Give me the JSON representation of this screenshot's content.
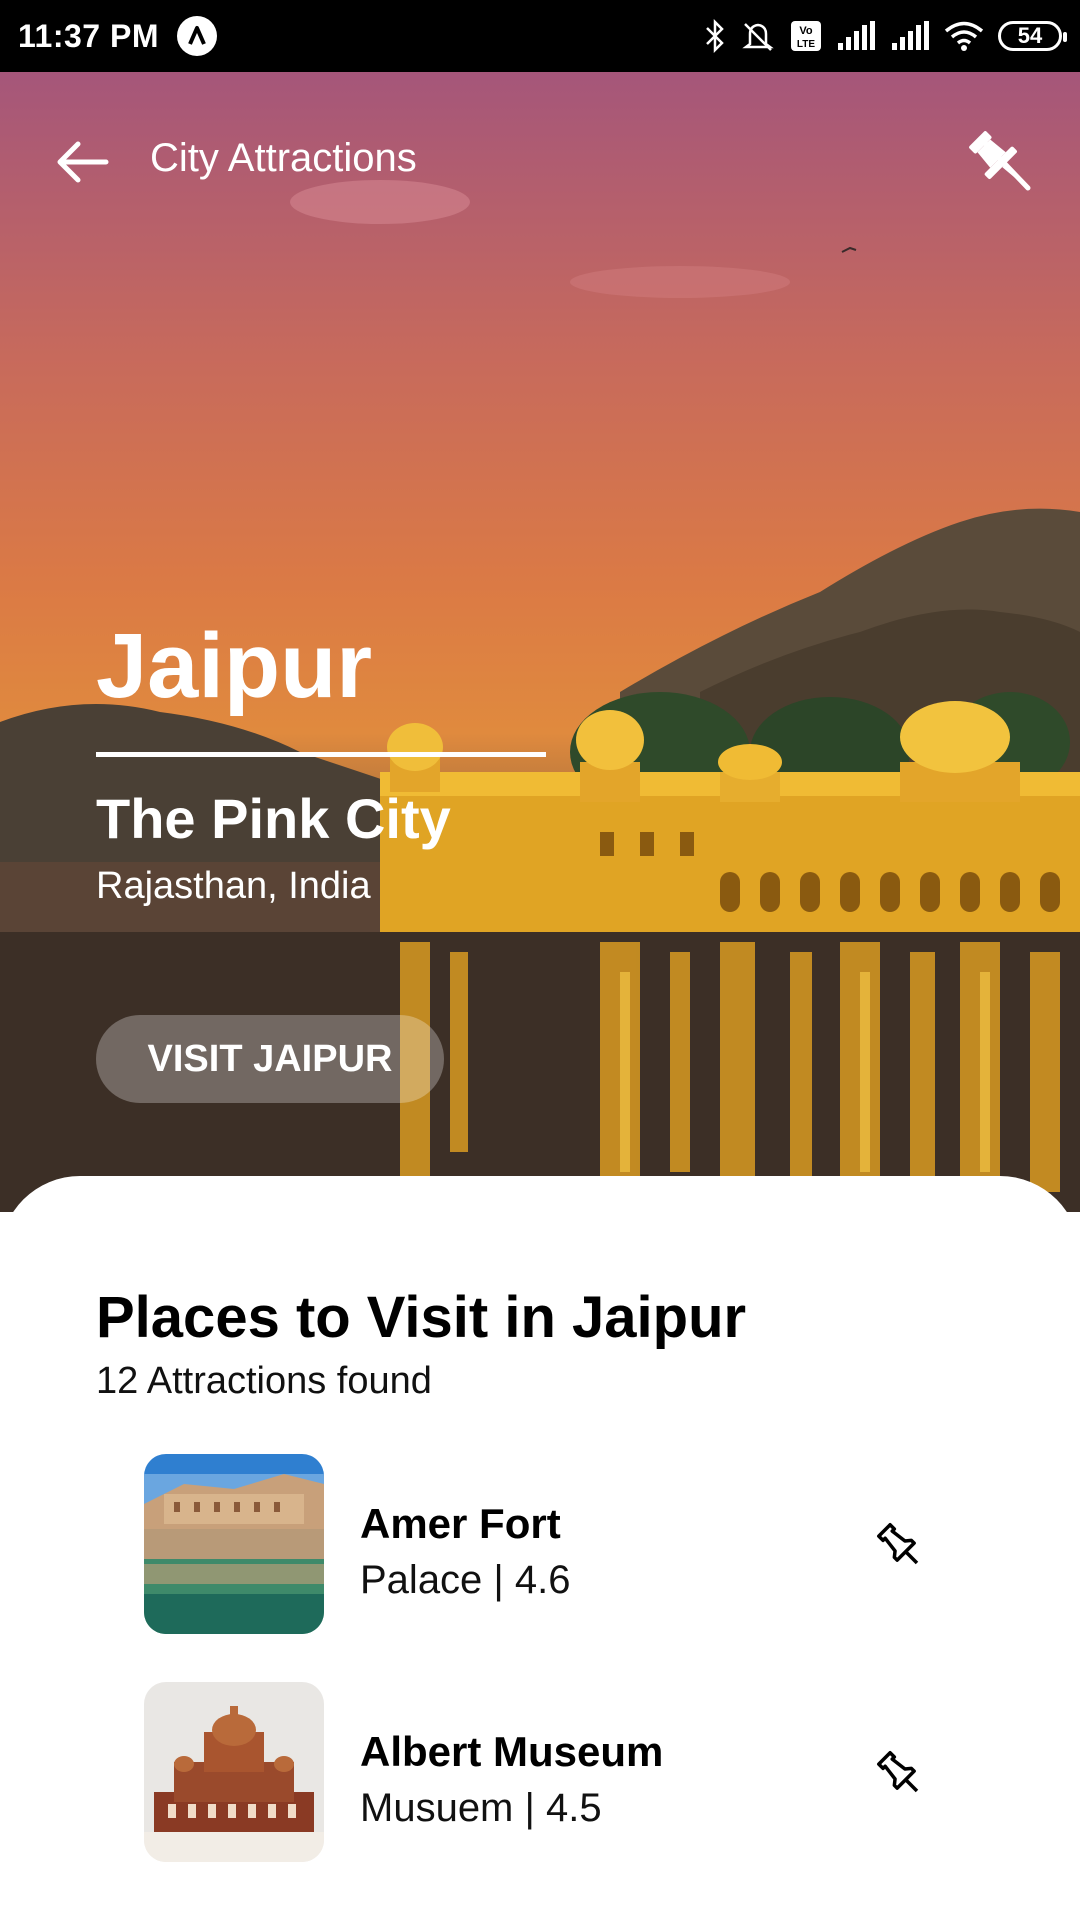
{
  "status_bar": {
    "time": "11:37 PM",
    "battery": "54",
    "icons": [
      "app-icon",
      "bluetooth-icon",
      "mute-icon",
      "volte-icon",
      "signal-icon",
      "signal-icon",
      "wifi-icon",
      "battery-icon"
    ]
  },
  "header": {
    "title": "City Attractions",
    "back_icon": "back-arrow-icon",
    "pin_icon": "pin-icon"
  },
  "hero": {
    "city": "Jaipur",
    "nickname": "The Pink City",
    "region": "Rajasthan, India",
    "cta_label": "VISIT JAIPUR"
  },
  "places": {
    "title": "Places to Visit in Jaipur",
    "count_label": "12 Attractions found",
    "items": [
      {
        "name": "Amer Fort",
        "meta": "Palace | 4.6"
      },
      {
        "name": "Albert Museum",
        "meta": "Musuem | 4.5"
      }
    ]
  }
}
